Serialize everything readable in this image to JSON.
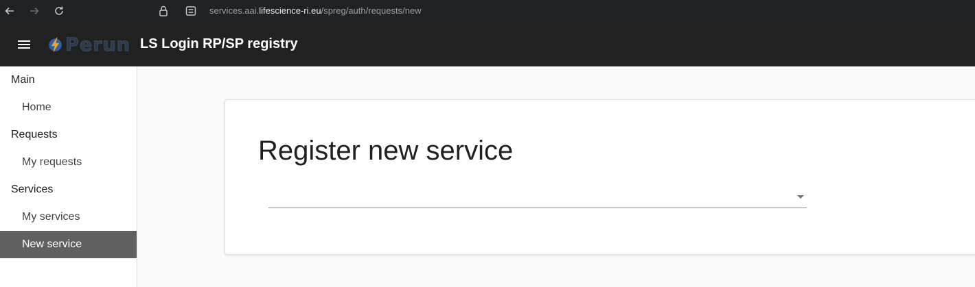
{
  "browser": {
    "url_prefix": "services.aai.",
    "url_host": "lifescience-ri.eu",
    "url_path": "/spreg/auth/requests/new"
  },
  "header": {
    "logo_text": "Perun",
    "title": "LS Login RP/SP registry"
  },
  "sidebar": {
    "sections": [
      {
        "label": "Main",
        "items": [
          {
            "label": "Home"
          }
        ]
      },
      {
        "label": "Requests",
        "items": [
          {
            "label": "My requests"
          }
        ]
      },
      {
        "label": "Services",
        "items": [
          {
            "label": "My services"
          },
          {
            "label": "New service",
            "active": true
          }
        ]
      }
    ]
  },
  "main": {
    "title": "Register new service",
    "select": {
      "value": ""
    }
  },
  "colors": {
    "header_bg": "#212121",
    "active_item_bg": "#616161",
    "logo_bolt": "#f5a623",
    "logo_circle": "#2b5fa8"
  }
}
